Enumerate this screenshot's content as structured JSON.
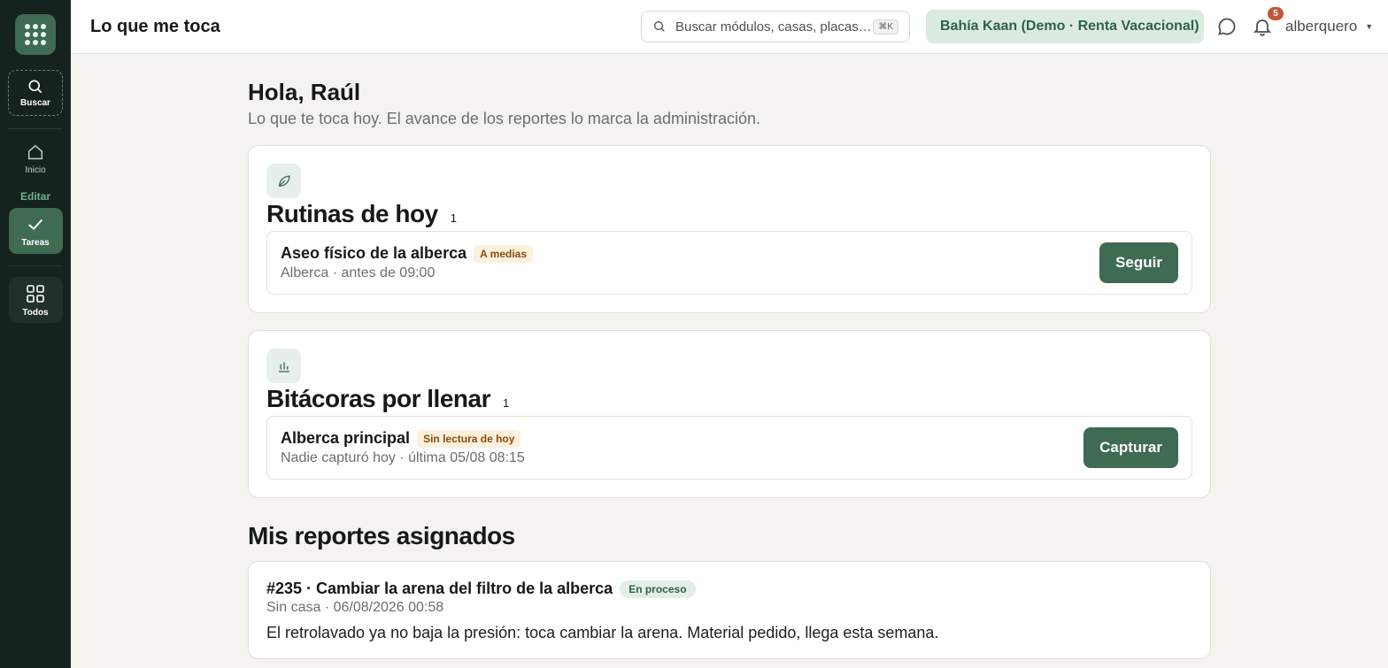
{
  "sidebar": {
    "search_label": "Buscar",
    "items": [
      {
        "label": "Inicio"
      },
      {
        "label": "Tareas"
      },
      {
        "label": "Todos"
      }
    ],
    "section_label": "Editar"
  },
  "header": {
    "title": "Lo que me toca",
    "search_placeholder": "Buscar módulos, casas, placas…",
    "search_shortcut": "⌘K",
    "site": "Bahía Kaan (Demo · Renta Vacacional)",
    "notifications_count": "5",
    "user": "alberquero",
    "icons": [
      "search-icon",
      "chat-icon",
      "bell-icon",
      "chevron-down-icon"
    ]
  },
  "greeting": {
    "title": "Hola, Raúl",
    "subtitle": "Lo que te toca hoy. El avance de los reportes lo marca la administración."
  },
  "routines": {
    "title": "Rutinas de hoy",
    "count": "1",
    "icon": "leaf-icon",
    "items": [
      {
        "title": "Aseo físico de la alberca",
        "tag": "A medias",
        "subtitle": "Alberca · antes de 09:00",
        "action": "Seguir"
      }
    ]
  },
  "logs": {
    "title": "Bitácoras por llenar",
    "count": "1",
    "icon": "bar-chart-icon",
    "items": [
      {
        "title": "Alberca principal",
        "tag": "Sin lectura de hoy",
        "subtitle": "Nadie capturó hoy · última 05/08 08:15",
        "action": "Capturar"
      }
    ]
  },
  "reports": {
    "title": "Mis reportes asignados",
    "items": [
      {
        "title": "#235 · Cambiar la arena del filtro de la alberca",
        "status": "En proceso",
        "subtitle": "Sin casa · 06/08/2026 00:58",
        "body": "El retrolavado ya no baja la presión: toca cambiar la arena. Material pedido, llega esta semana."
      }
    ]
  },
  "colors": {
    "sidebar_bg": "#16221d",
    "accent": "#3e6b52",
    "tag_warn_bg": "#fbf1dc",
    "tag_ok_bg": "#e3efe6",
    "badge": "#c4543a"
  }
}
